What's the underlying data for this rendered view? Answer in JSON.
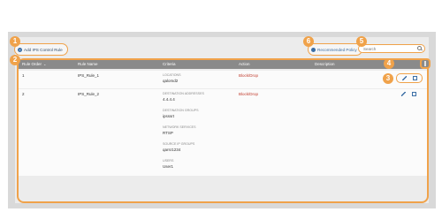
{
  "toolbar": {
    "add_rule_label": "Add IPS Control Rule",
    "recommended_label": "Recommended Policy",
    "search_placeholder": "Search"
  },
  "table": {
    "headers": [
      "Rule Order",
      "Rule Name",
      "Criteria",
      "Action",
      "Description"
    ],
    "rows": [
      {
        "order": "1",
        "name": "IPS_Rule_1",
        "criteria": [
          {
            "label": "LOCATIONS",
            "value": "qalomd2"
          }
        ],
        "action": "Block/Drop",
        "description": ""
      },
      {
        "order": "2",
        "name": "IPS_Rule_2",
        "criteria": [
          {
            "label": "DESTINATION ADDRESSES",
            "value": "4.4.4.4"
          },
          {
            "label": "DESTINATION GROUPS",
            "value": "ipsssrt"
          },
          {
            "label": "NETWORK SERVICES",
            "value": "RTSP"
          },
          {
            "label": "SOURCE IP GROUPS",
            "value": "qarsr1234"
          },
          {
            "label": "USERS",
            "value": "User1"
          }
        ],
        "action": "Block/Drop",
        "description": ""
      }
    ]
  },
  "badges": [
    "1",
    "2",
    "3",
    "4",
    "5",
    "6"
  ],
  "colors": {
    "accent": "#f0a24a",
    "link": "#3b6ea5",
    "action": "#c0392b",
    "header_bg": "#8a8a8a"
  }
}
